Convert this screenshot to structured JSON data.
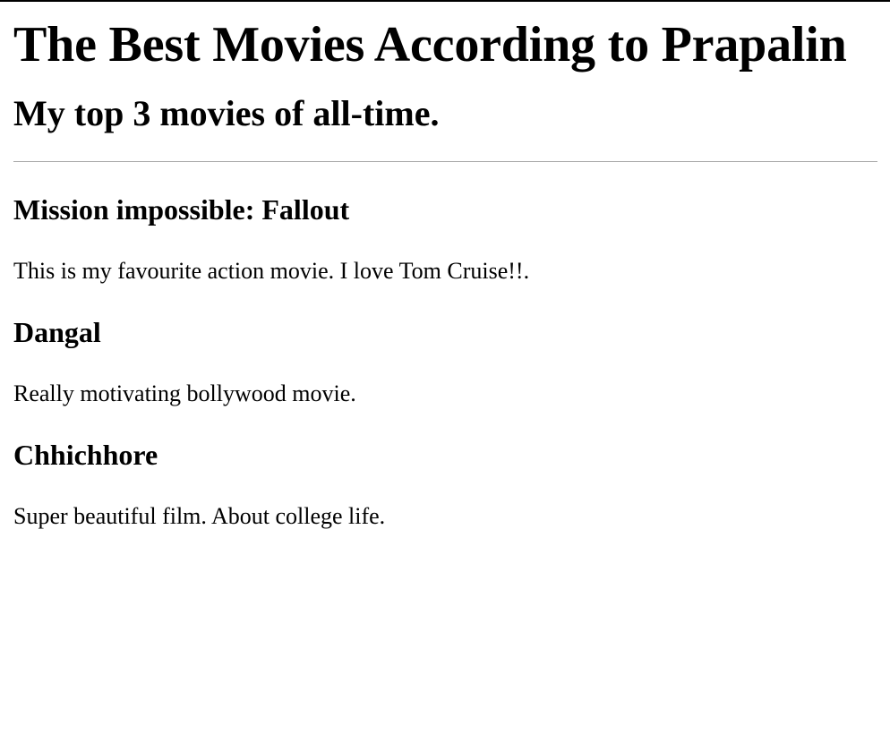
{
  "header": {
    "title": "The Best Movies According to Prapalin",
    "subtitle": "My top 3 movies of all-time."
  },
  "movies": [
    {
      "title": "Mission impossible: Fallout",
      "description": "This is my favourite action movie. I love Tom Cruise!!."
    },
    {
      "title": "Dangal",
      "description": "Really motivating bollywood movie."
    },
    {
      "title": "Chhichhore",
      "description": "Super beautiful film. About college life."
    }
  ]
}
